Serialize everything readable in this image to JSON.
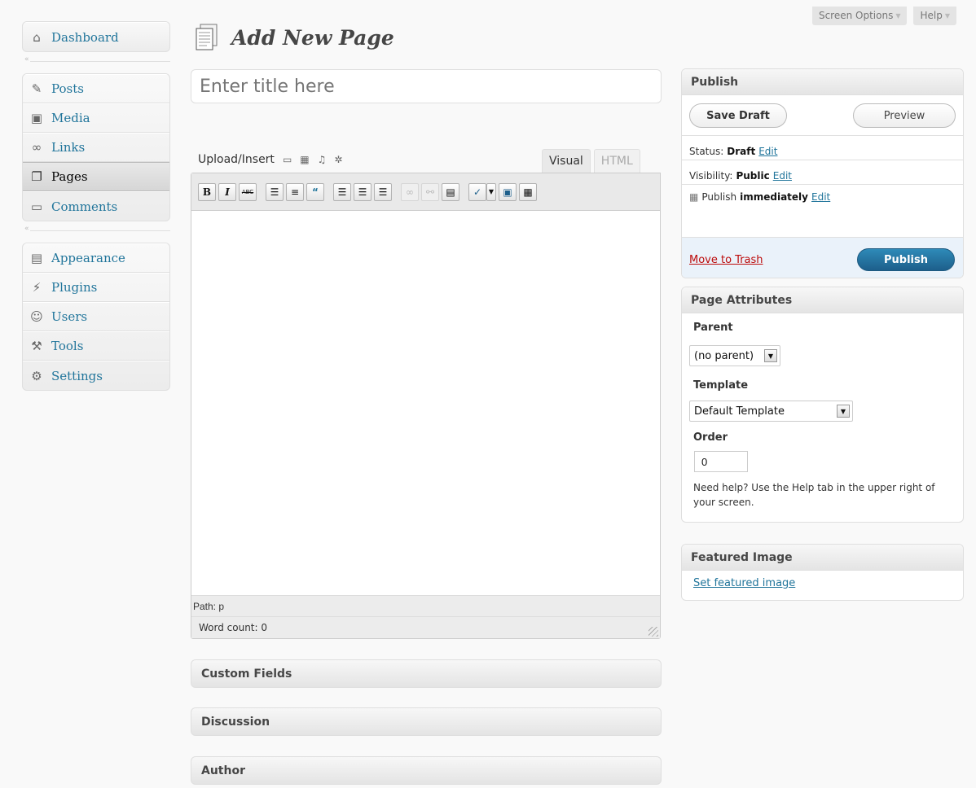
{
  "screen_meta": {
    "screen_options": "Screen Options",
    "help": "Help"
  },
  "sidebar": {
    "group1": [
      {
        "label": "Dashboard",
        "icon": "dashboard-icon"
      }
    ],
    "group2": [
      {
        "label": "Posts",
        "icon": "posts-icon"
      },
      {
        "label": "Media",
        "icon": "media-icon"
      },
      {
        "label": "Links",
        "icon": "links-icon"
      },
      {
        "label": "Pages",
        "icon": "pages-icon"
      },
      {
        "label": "Comments",
        "icon": "comments-icon"
      }
    ],
    "group3": [
      {
        "label": "Appearance",
        "icon": "appearance-icon"
      },
      {
        "label": "Plugins",
        "icon": "plugins-icon"
      },
      {
        "label": "Users",
        "icon": "users-icon"
      },
      {
        "label": "Tools",
        "icon": "tools-icon"
      },
      {
        "label": "Settings",
        "icon": "settings-icon"
      }
    ],
    "current": "Pages"
  },
  "page": {
    "title": "Add New Page"
  },
  "title_field": {
    "placeholder": "Enter title here"
  },
  "editor": {
    "upload_insert": "Upload/Insert",
    "tab_visual": "Visual",
    "tab_html": "HTML",
    "path": "Path: p",
    "word_count": "Word count: 0",
    "toolbar": {
      "bold": "B",
      "italic": "I",
      "strike": "ABC"
    }
  },
  "boxes": {
    "custom_fields": "Custom Fields",
    "discussion": "Discussion",
    "author": "Author"
  },
  "publish": {
    "title": "Publish",
    "save_draft": "Save Draft",
    "preview": "Preview",
    "status_label": "Status:",
    "status_value": "Draft",
    "visibility_label": "Visibility:",
    "visibility_value": "Public",
    "publish_label": "Publish",
    "publish_value": "immediately",
    "edit": "Edit",
    "move_to_trash": "Move to Trash",
    "publish_button": "Publish"
  },
  "page_attributes": {
    "title": "Page Attributes",
    "parent_label": "Parent",
    "parent_value": "(no parent)",
    "template_label": "Template",
    "template_value": "Default Template",
    "order_label": "Order",
    "order_value": "0",
    "help": "Need help? Use the Help tab in the upper right of your screen."
  },
  "featured_image": {
    "title": "Featured Image",
    "link": "Set featured image"
  }
}
